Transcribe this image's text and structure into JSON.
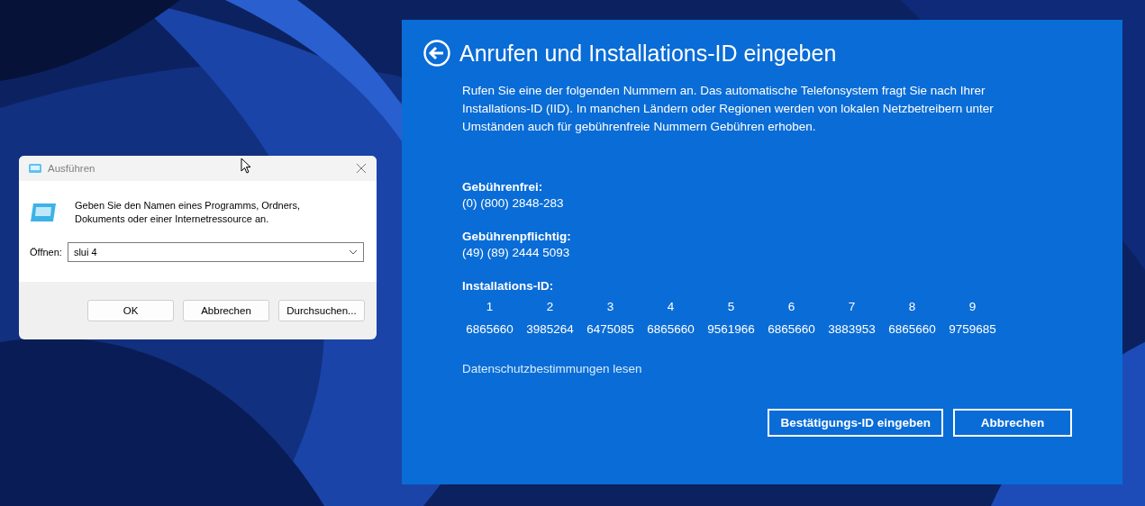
{
  "run_dialog": {
    "title": "Ausführen",
    "description": "Geben Sie den Namen eines Programms, Ordners, Dokuments oder einer Internetressource an.",
    "open_label": "Öffnen:",
    "open_value": "slui 4",
    "buttons": [
      "OK",
      "Abbrechen",
      "Durchsuchen..."
    ]
  },
  "activation": {
    "title": "Anrufen und Installations-ID eingeben",
    "intro": "Rufen Sie eine der folgenden Nummern an. Das automatische Telefonsystem fragt Sie nach Ihrer Installations-ID (IID). In manchen Ländern oder Regionen werden von lokalen Netzbetreibern unter Umständen auch für gebührenfreie Nummern Gebühren erhoben.",
    "numbers": [
      {
        "label": "Gebührenfrei:",
        "value": "(0) (800) 2848-283"
      },
      {
        "label": "Gebührenpflichtig:",
        "value": "(49) (89) 2444 5093"
      }
    ],
    "id_label": "Installations-ID:",
    "id_blocks": [
      {
        "index": "1",
        "value": "6865660"
      },
      {
        "index": "2",
        "value": "3985264"
      },
      {
        "index": "3",
        "value": "6475085"
      },
      {
        "index": "4",
        "value": "6865660"
      },
      {
        "index": "5",
        "value": "9561966"
      },
      {
        "index": "6",
        "value": "6865660"
      },
      {
        "index": "7",
        "value": "3883953"
      },
      {
        "index": "8",
        "value": "6865660"
      },
      {
        "index": "9",
        "value": "9759685"
      }
    ],
    "privacy_link": "Datenschutzbestimmungen lesen",
    "buttons": [
      "Bestätigungs-ID eingeben",
      "Abbrechen"
    ]
  }
}
